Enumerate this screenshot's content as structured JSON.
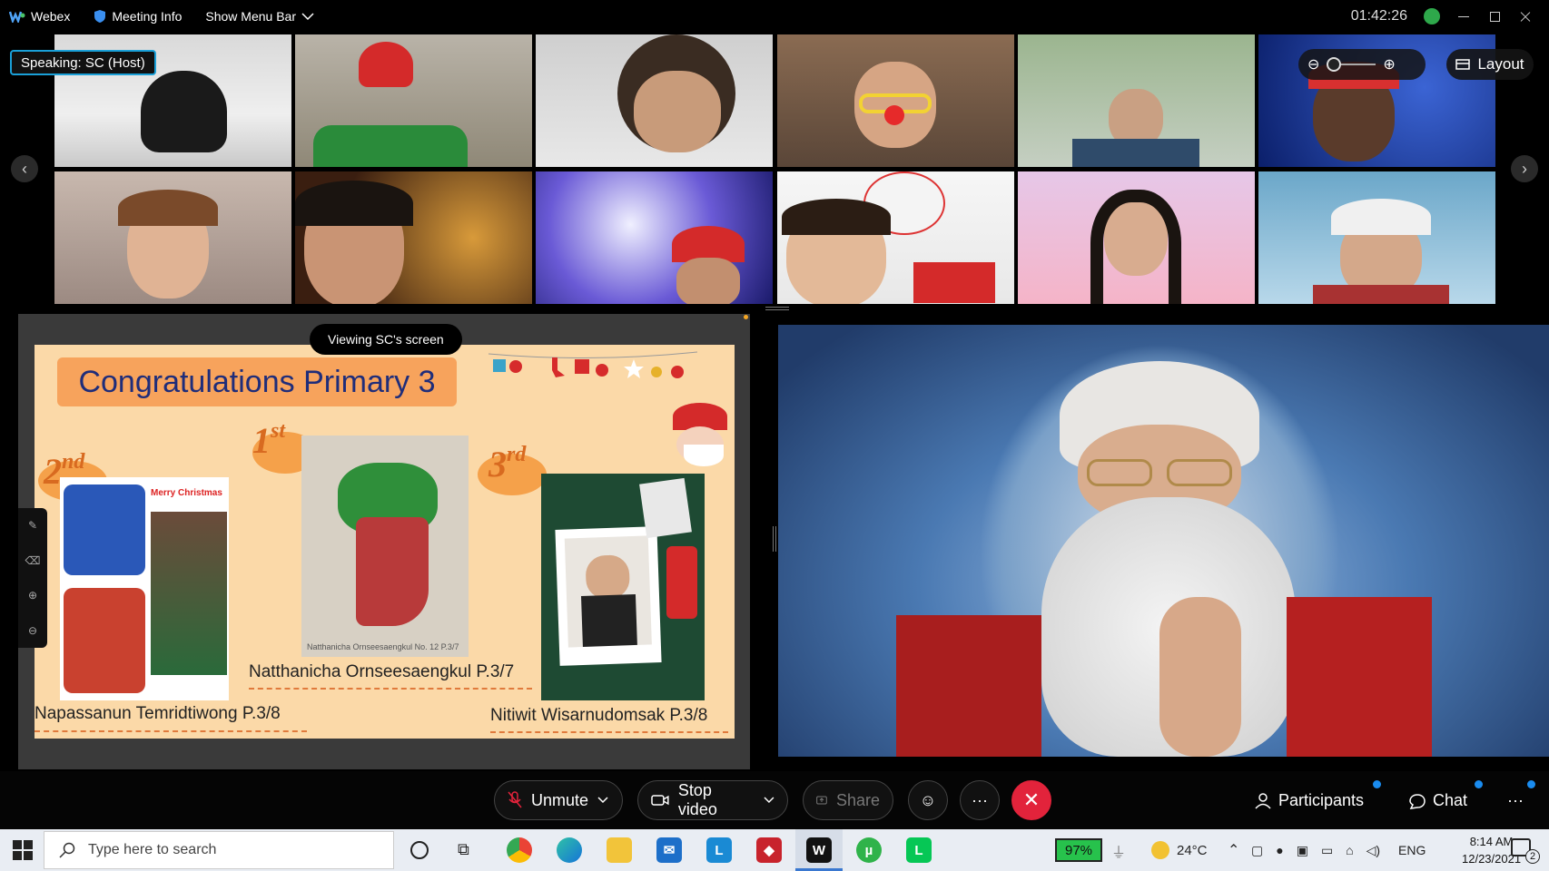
{
  "app": {
    "name": "Webex",
    "meeting_info": "Meeting Info",
    "show_menu_bar": "Show Menu Bar",
    "timer": "01:42:26"
  },
  "speaking_label": "Speaking: SC (Host)",
  "layout_label": "Layout",
  "share": {
    "viewing": "Viewing SC's screen",
    "title": "Congratulations Primary 3",
    "first": {
      "place": "1",
      "suffix": "st",
      "name": "Natthanicha Ornseesaengkul  P.3/7"
    },
    "second": {
      "place": "2",
      "suffix": "nd",
      "name": "Napassanun Temridtiwong  P.3/8"
    },
    "third": {
      "place": "3",
      "suffix": "rd",
      "name": "Nitiwit Wisarnudomsak  P.3/8"
    },
    "merry": "Merry Christmas",
    "caption": "Natthanicha Ornseesaengkul  No. 12  P.3/7"
  },
  "toolbar": {
    "unmute": "Unmute",
    "stop_video": "Stop video",
    "share": "Share",
    "participants": "Participants",
    "chat": "Chat"
  },
  "taskbar": {
    "search_placeholder": "Type here to search",
    "battery": "97%",
    "temp": "24°C",
    "lang": "ENG",
    "time": "8:14 AM",
    "date": "12/23/2021",
    "notifications": "2"
  },
  "colors": {
    "accent": "#1aa0d8",
    "end_call": "#e2233b",
    "slide_bg": "#fbd9a8",
    "title_bg": "#f7a35c",
    "title_text": "#1f2d7a"
  }
}
